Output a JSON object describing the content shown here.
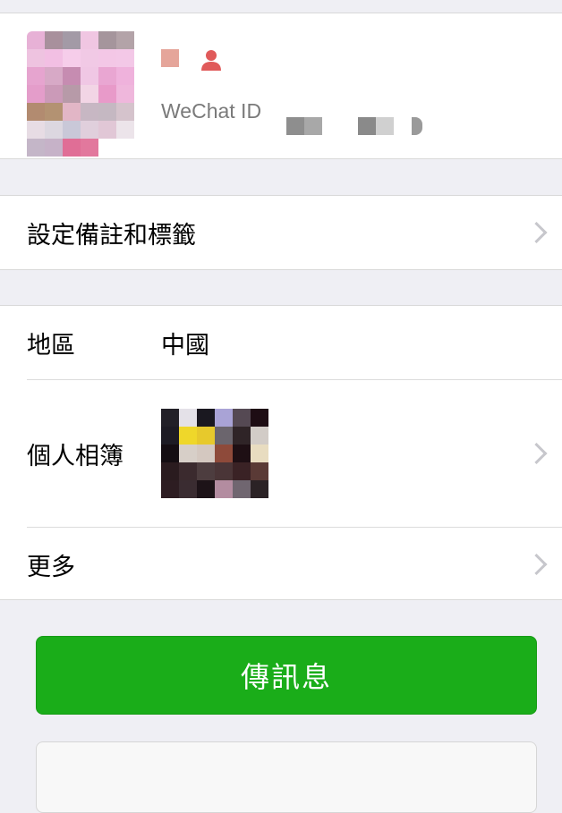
{
  "profile": {
    "wechat_id_label": "WeChat ID",
    "avatar_colors": [
      "#e7b1d6",
      "#a8909c",
      "#a39aa6",
      "#f0c6e2",
      "#a5959c",
      "#b3a3a8",
      "#eec3e0",
      "#f2bfe3",
      "#f6cdea",
      "#f1c9e5",
      "#f3c7e6",
      "#f3c8e7",
      "#e6a4cf",
      "#d7a9c6",
      "#c68cb1",
      "#f0c7e4",
      "#e9a6d2",
      "#efb2dc",
      "#e49dca",
      "#cb9ab8",
      "#b79aa8",
      "#f2d5e5",
      "#e89ac9",
      "#efb7dc",
      "#b28b70",
      "#b39272",
      "#e2b6c6",
      "#c7b7c3",
      "#c5b8c2",
      "#d5c3cc",
      "#e7dce4",
      "#dcd7e0",
      "#c9c8d8",
      "#e0cfdc",
      "#e1c7d6",
      "#ece4ea",
      "#c4b6c8",
      "#c6b2c8",
      "#e06e96",
      "#e2789d",
      "#ffffff",
      "#ffffff"
    ],
    "name_colors": [
      "#e5a59a",
      "#e05a5a"
    ]
  },
  "remark_row": {
    "label": "設定備註和標籤"
  },
  "region_row": {
    "label": "地區",
    "value": "中國"
  },
  "album_row": {
    "label": "個人相簿",
    "thumb_colors": [
      "#222028",
      "#e4e1e8",
      "#1a1820",
      "#a9a3d6",
      "#554953",
      "#1e0d14",
      "#1d1b24",
      "#efd72a",
      "#e7c92c",
      "#6b656d",
      "#2f2427",
      "#d2ccc7",
      "#140d12",
      "#d7cfc8",
      "#d4c8c0",
      "#8e4a3a",
      "#1e0f14",
      "#e8dcc0",
      "#2a1b1f",
      "#3b2a2e",
      "#4d3d3f",
      "#4a3537",
      "#3a2225",
      "#5a3a36",
      "#2d1d22",
      "#3a2c31",
      "#1d1318",
      "#b38ca0",
      "#706670",
      "#2b2225"
    ]
  },
  "more_row": {
    "label": "更多"
  },
  "send_button": {
    "label": "傳訊息"
  }
}
